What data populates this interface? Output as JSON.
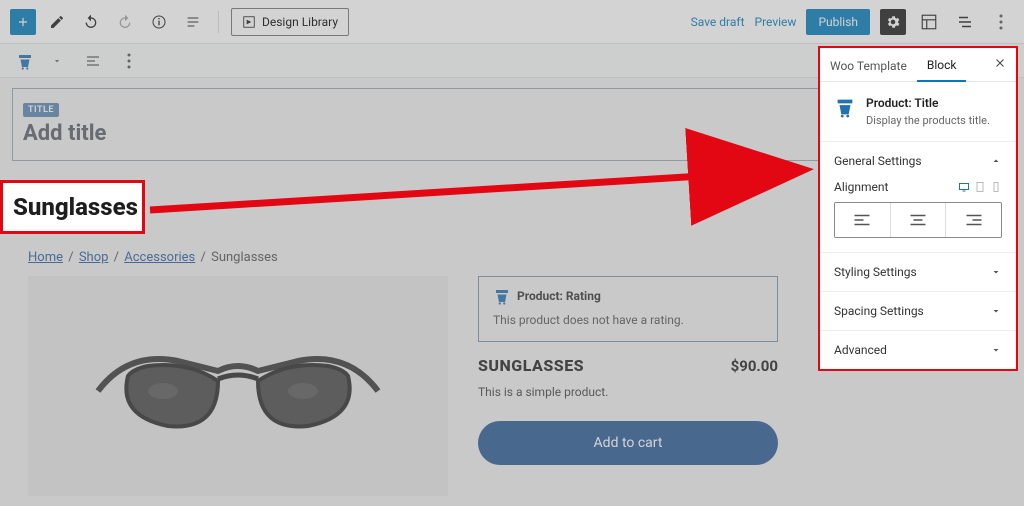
{
  "topbar": {
    "design_library": "Design Library",
    "save_draft": "Save draft",
    "preview": "Preview",
    "publish": "Publish"
  },
  "title_block": {
    "tag": "TITLE",
    "placeholder": "Add title"
  },
  "callout_title": "Sunglasses",
  "breadcrumb": {
    "home": "Home",
    "shop": "Shop",
    "accessories": "Accessories",
    "current": "Sunglasses"
  },
  "rating_block": {
    "label": "Product: Rating",
    "empty_msg": "This product does not have a rating."
  },
  "product": {
    "name": "SUNGLASSES",
    "price": "$90.00",
    "desc": "This is a simple product.",
    "add_to_cart": "Add to cart"
  },
  "sidebar": {
    "tabs": {
      "woo": "Woo Template",
      "block": "Block"
    },
    "block_name": "Product: Title",
    "block_desc": "Display the products title.",
    "sections": {
      "general": "General Settings",
      "alignment_label": "Alignment",
      "styling": "Styling Settings",
      "spacing": "Spacing Settings",
      "advanced": "Advanced"
    }
  }
}
